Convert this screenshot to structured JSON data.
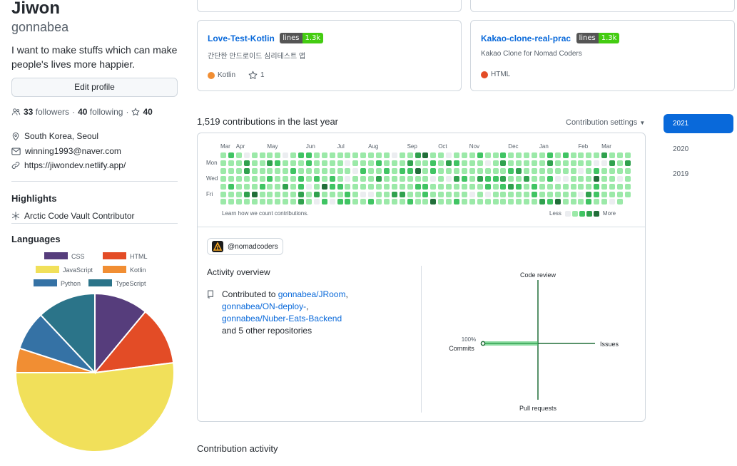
{
  "profile": {
    "name": "Jiwon",
    "login": "gonnabea",
    "bio": "I want to make stuffs which can make people's lives more happier.",
    "edit_label": "Edit profile",
    "followers_count": "33",
    "followers_label": "followers",
    "following_count": "40",
    "following_label": "following",
    "sep": "·",
    "stars": "40",
    "location": "South Korea, Seoul",
    "email": "winning1993@naver.com",
    "website": "https://jiwondev.netlify.app/"
  },
  "highlights": {
    "title": "Highlights",
    "item": "Arctic Code Vault Contributor"
  },
  "languages": {
    "title": "Languages",
    "legend": [
      {
        "name": "CSS",
        "color": "#563d7c"
      },
      {
        "name": "HTML",
        "color": "#e34c26"
      },
      {
        "name": "JavaScript",
        "color": "#f1e05a"
      },
      {
        "name": "Kotlin",
        "color": "#F18E33"
      },
      {
        "name": "Python",
        "color": "#3572A5"
      },
      {
        "name": "TypeScript",
        "color": "#2b7489"
      }
    ],
    "shares": [
      {
        "name": "CSS",
        "value": 11
      },
      {
        "name": "HTML",
        "value": 12
      },
      {
        "name": "JavaScript",
        "value": 52
      },
      {
        "name": "Kotlin",
        "value": 5
      },
      {
        "name": "Python",
        "value": 8
      },
      {
        "name": "TypeScript",
        "value": 12
      }
    ]
  },
  "repos": [
    {
      "name": "Love-Test-Kotlin",
      "badge_label": "lines",
      "badge_value": "1.3k",
      "desc": "간단한 안드로이드 심리테스트 앱",
      "lang": "Kotlin",
      "lang_color": "#F18E33",
      "stars": "1"
    },
    {
      "name": "Kakao-clone-real-prac",
      "badge_label": "lines",
      "badge_value": "1.3k",
      "desc": "Kakao Clone for Nomad Coders",
      "lang": "HTML",
      "lang_color": "#e34c26"
    }
  ],
  "contrib": {
    "title": "1,519 contributions in the last year",
    "settings": "Contribution settings",
    "months": [
      "Mar",
      "Apr",
      "May",
      "Jun",
      "Jul",
      "Aug",
      "Sep",
      "Oct",
      "Nov",
      "Dec",
      "Jan",
      "Feb",
      "Mar"
    ],
    "days": [
      "Mon",
      "Wed",
      "Fri"
    ],
    "learn": "Learn how we count contributions.",
    "less": "Less",
    "more": "More",
    "palette": [
      "#ebedf0",
      "#9be9a8",
      "#40c463",
      "#30a14e",
      "#216e39"
    ]
  },
  "org": {
    "handle": "@nomadcoders"
  },
  "overview": {
    "title": "Activity overview",
    "contributed_to": "Contributed to",
    "repo1": "gonnabea/JRoom",
    "comma1": ",",
    "repo2": "gonnabea/ON-deploy-",
    "comma2": ",",
    "repo3": "gonnabea/Nuber-Eats-Backend",
    "others": "and 5 other repositories",
    "axes": {
      "code_review": "Code review",
      "issues": "Issues",
      "pull_requests": "Pull requests",
      "commits": "Commits",
      "commits_pct": "100%"
    }
  },
  "years": [
    "2021",
    "2020",
    "2019"
  ],
  "activity_title": "Contribution activity"
}
